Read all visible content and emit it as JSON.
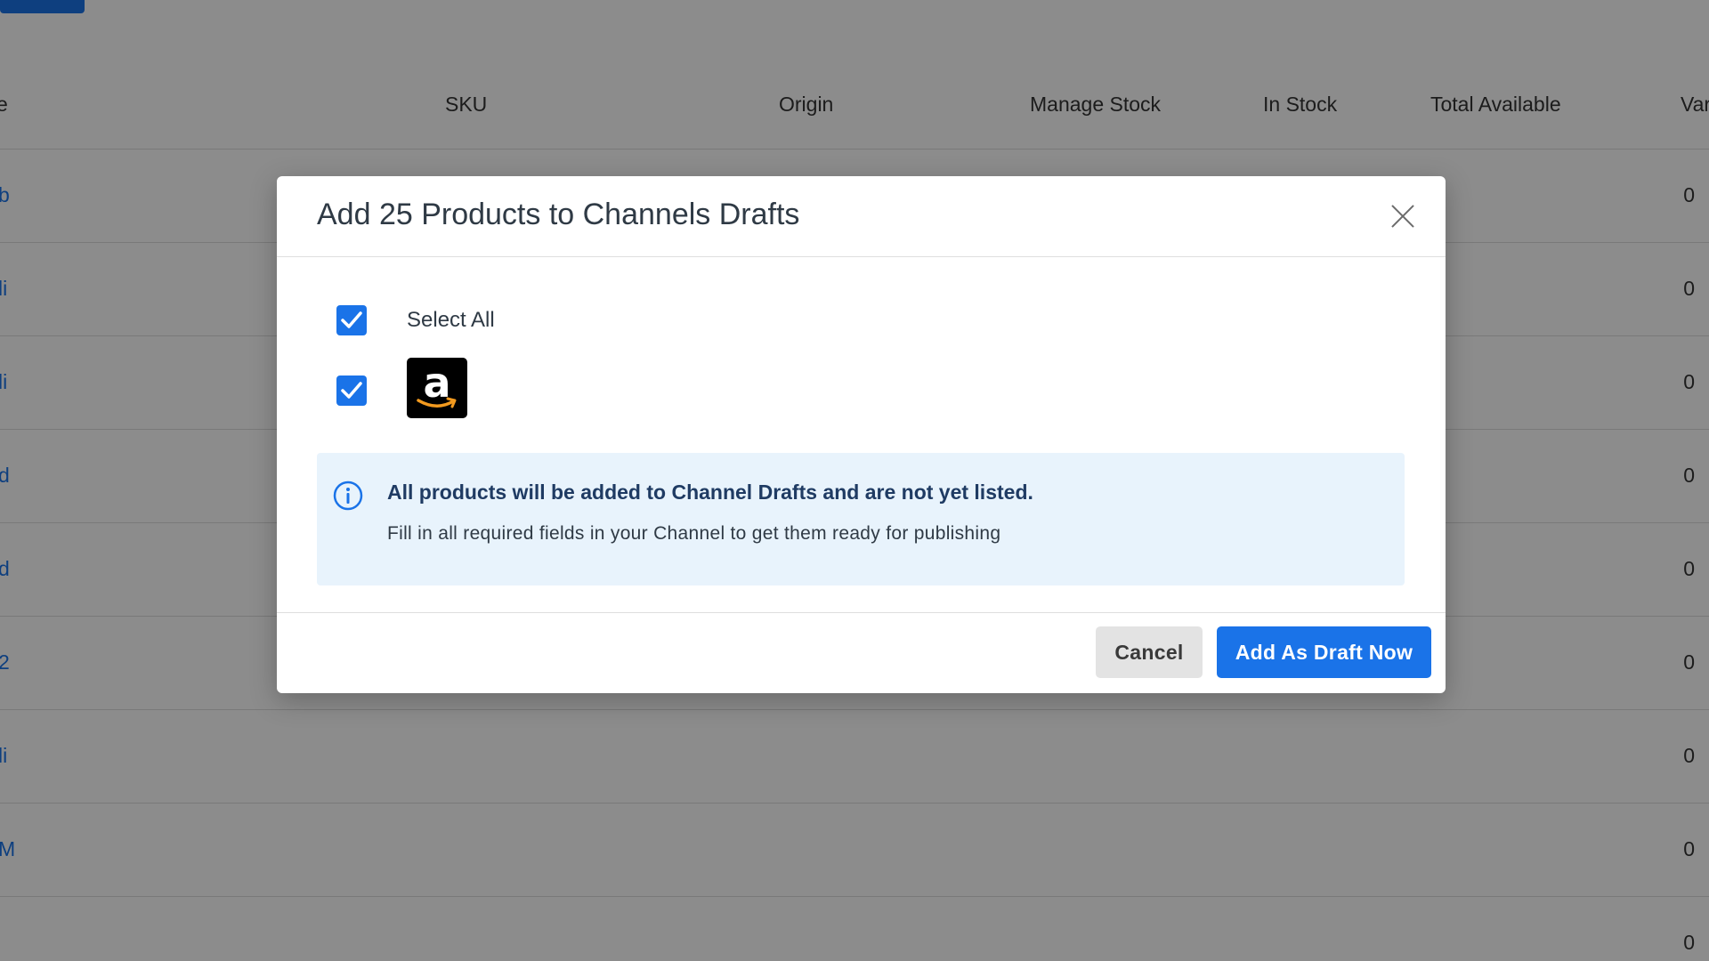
{
  "table": {
    "headers": {
      "name": "e",
      "sku": "SKU",
      "origin": "Origin",
      "manage_stock": "Manage Stock",
      "in_stock": "In Stock",
      "total_available": "Total Available",
      "variants": "Var"
    },
    "rows": [
      {
        "name": "b",
        "value": "0"
      },
      {
        "name": "li",
        "value": "0"
      },
      {
        "name": "li",
        "value": "0"
      },
      {
        "name": "d",
        "value": "0"
      },
      {
        "name": "d",
        "value": "0"
      },
      {
        "name": "2",
        "value": "0"
      },
      {
        "name": "li",
        "value": "0"
      },
      {
        "name": "M",
        "value": "0"
      },
      {
        "name": "",
        "value": "0"
      }
    ]
  },
  "modal": {
    "title": "Add 25 Products to Channels Drafts",
    "select_all_label": "Select All",
    "channels": [
      {
        "icon": "amazon-logo",
        "checked": true
      }
    ],
    "info": {
      "title": "All products will be added to Channel Drafts and are not yet listed.",
      "text": "Fill in all required fields in your Channel to get them ready for publishing"
    },
    "buttons": {
      "cancel": "Cancel",
      "primary": "Add As Draft Now"
    }
  },
  "colors": {
    "accent": "#1a73e8",
    "info_bg": "#e8f3fc",
    "overlay": "rgba(0,0,0,0.45)"
  }
}
